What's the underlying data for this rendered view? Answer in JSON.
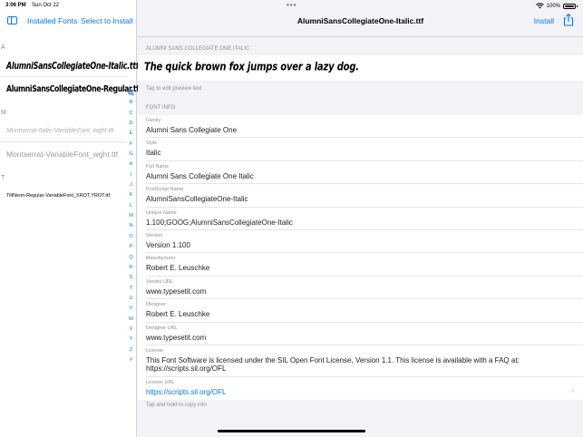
{
  "status": {
    "time": "3:06 PM",
    "date": "Sun Oct 22",
    "dots": "•••",
    "battery": "100%",
    "battery_level": 1.0
  },
  "sidebar": {
    "installed_fonts": "Installed Fonts",
    "select_to_install": "Select to Install",
    "sections": [
      {
        "letter": "A",
        "fonts": [
          "AlumniSansCollegiateOne-Italic.ttf",
          "AlumniSansCollegiateOne-Regular.ttf"
        ]
      },
      {
        "letter": "M",
        "fonts": [
          "Montserrat-Italic-VariableFont_wght.ttf",
          "Montserrat-VariableFont_wght.ttf"
        ]
      },
      {
        "letter": "T",
        "fonts": [
          "TiltNeon-Regular-VariableFont_XROT,YROT.ttf"
        ]
      }
    ],
    "index": [
      "A",
      "B",
      "C",
      "D",
      "E",
      "F",
      "G",
      "H",
      "I",
      "J",
      "K",
      "L",
      "M",
      "N",
      "O",
      "P",
      "Q",
      "R",
      "S",
      "T",
      "U",
      "V",
      "W",
      "X",
      "Y",
      "Z",
      "#"
    ]
  },
  "detail": {
    "title": "AlumniSansCollegiateOne-Italic.ttf",
    "install": "Install",
    "preview_label": "ALUMNI SANS COLLEGIATE ONE ITALIC",
    "preview_text": "The quick brown fox jumps over a lazy dog.",
    "preview_hint": "Tap to edit preview text",
    "font_info_label": "FONT INFO",
    "info": [
      {
        "label": "Family",
        "value": "Alumni Sans Collegiate One"
      },
      {
        "label": "Style",
        "value": "Italic"
      },
      {
        "label": "Full Name",
        "value": "Alumni Sans Collegiate One Italic"
      },
      {
        "label": "PostScript Name",
        "value": "AlumniSansCollegiateOne-Italic"
      },
      {
        "label": "Unique Name",
        "value": "1.100;GOOG;AlumniSansCollegiateOne-Italic"
      },
      {
        "label": "Version",
        "value": "Version 1.100"
      },
      {
        "label": "Manufacturer",
        "value": "Robert E. Leuschke"
      },
      {
        "label": "Vendor URL",
        "value": "www.typesetit.com"
      },
      {
        "label": "Designer",
        "value": "Robert E. Leuschke"
      },
      {
        "label": "Designer URL",
        "value": "www.typesetit.com"
      },
      {
        "label": "License",
        "value": "This Font Software is licensed under the SIL Open Font License, Version 1.1. This license is available with a FAQ at: https://scripts.sil.org/OFL"
      },
      {
        "label": "License URL",
        "value": "https://scripts.sil.org/OFL"
      }
    ],
    "copy_hint": "Tap and hold to copy info"
  },
  "colors": {
    "accent": "#007aff",
    "secondary_text": "#8e8e93",
    "background": "#f2f2f7"
  }
}
